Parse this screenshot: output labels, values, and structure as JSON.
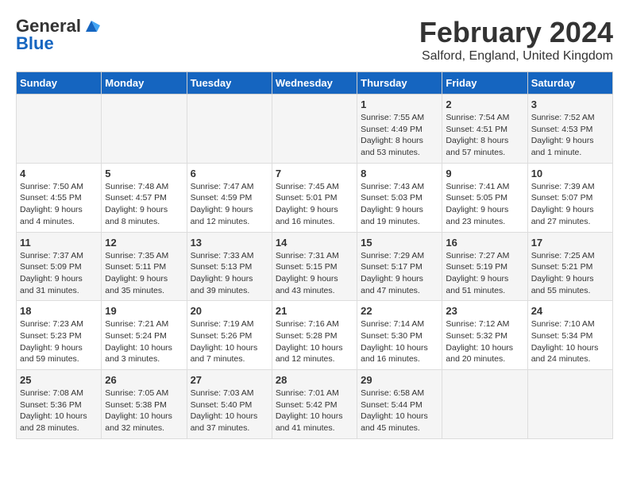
{
  "logo": {
    "general": "General",
    "blue": "Blue"
  },
  "header": {
    "month": "February 2024",
    "location": "Salford, England, United Kingdom"
  },
  "weekdays": [
    "Sunday",
    "Monday",
    "Tuesday",
    "Wednesday",
    "Thursday",
    "Friday",
    "Saturday"
  ],
  "weeks": [
    [
      {
        "day": "",
        "info": ""
      },
      {
        "day": "",
        "info": ""
      },
      {
        "day": "",
        "info": ""
      },
      {
        "day": "",
        "info": ""
      },
      {
        "day": "1",
        "info": "Sunrise: 7:55 AM\nSunset: 4:49 PM\nDaylight: 8 hours\nand 53 minutes."
      },
      {
        "day": "2",
        "info": "Sunrise: 7:54 AM\nSunset: 4:51 PM\nDaylight: 8 hours\nand 57 minutes."
      },
      {
        "day": "3",
        "info": "Sunrise: 7:52 AM\nSunset: 4:53 PM\nDaylight: 9 hours\nand 1 minute."
      }
    ],
    [
      {
        "day": "4",
        "info": "Sunrise: 7:50 AM\nSunset: 4:55 PM\nDaylight: 9 hours\nand 4 minutes."
      },
      {
        "day": "5",
        "info": "Sunrise: 7:48 AM\nSunset: 4:57 PM\nDaylight: 9 hours\nand 8 minutes."
      },
      {
        "day": "6",
        "info": "Sunrise: 7:47 AM\nSunset: 4:59 PM\nDaylight: 9 hours\nand 12 minutes."
      },
      {
        "day": "7",
        "info": "Sunrise: 7:45 AM\nSunset: 5:01 PM\nDaylight: 9 hours\nand 16 minutes."
      },
      {
        "day": "8",
        "info": "Sunrise: 7:43 AM\nSunset: 5:03 PM\nDaylight: 9 hours\nand 19 minutes."
      },
      {
        "day": "9",
        "info": "Sunrise: 7:41 AM\nSunset: 5:05 PM\nDaylight: 9 hours\nand 23 minutes."
      },
      {
        "day": "10",
        "info": "Sunrise: 7:39 AM\nSunset: 5:07 PM\nDaylight: 9 hours\nand 27 minutes."
      }
    ],
    [
      {
        "day": "11",
        "info": "Sunrise: 7:37 AM\nSunset: 5:09 PM\nDaylight: 9 hours\nand 31 minutes."
      },
      {
        "day": "12",
        "info": "Sunrise: 7:35 AM\nSunset: 5:11 PM\nDaylight: 9 hours\nand 35 minutes."
      },
      {
        "day": "13",
        "info": "Sunrise: 7:33 AM\nSunset: 5:13 PM\nDaylight: 9 hours\nand 39 minutes."
      },
      {
        "day": "14",
        "info": "Sunrise: 7:31 AM\nSunset: 5:15 PM\nDaylight: 9 hours\nand 43 minutes."
      },
      {
        "day": "15",
        "info": "Sunrise: 7:29 AM\nSunset: 5:17 PM\nDaylight: 9 hours\nand 47 minutes."
      },
      {
        "day": "16",
        "info": "Sunrise: 7:27 AM\nSunset: 5:19 PM\nDaylight: 9 hours\nand 51 minutes."
      },
      {
        "day": "17",
        "info": "Sunrise: 7:25 AM\nSunset: 5:21 PM\nDaylight: 9 hours\nand 55 minutes."
      }
    ],
    [
      {
        "day": "18",
        "info": "Sunrise: 7:23 AM\nSunset: 5:23 PM\nDaylight: 9 hours\nand 59 minutes."
      },
      {
        "day": "19",
        "info": "Sunrise: 7:21 AM\nSunset: 5:24 PM\nDaylight: 10 hours\nand 3 minutes."
      },
      {
        "day": "20",
        "info": "Sunrise: 7:19 AM\nSunset: 5:26 PM\nDaylight: 10 hours\nand 7 minutes."
      },
      {
        "day": "21",
        "info": "Sunrise: 7:16 AM\nSunset: 5:28 PM\nDaylight: 10 hours\nand 12 minutes."
      },
      {
        "day": "22",
        "info": "Sunrise: 7:14 AM\nSunset: 5:30 PM\nDaylight: 10 hours\nand 16 minutes."
      },
      {
        "day": "23",
        "info": "Sunrise: 7:12 AM\nSunset: 5:32 PM\nDaylight: 10 hours\nand 20 minutes."
      },
      {
        "day": "24",
        "info": "Sunrise: 7:10 AM\nSunset: 5:34 PM\nDaylight: 10 hours\nand 24 minutes."
      }
    ],
    [
      {
        "day": "25",
        "info": "Sunrise: 7:08 AM\nSunset: 5:36 PM\nDaylight: 10 hours\nand 28 minutes."
      },
      {
        "day": "26",
        "info": "Sunrise: 7:05 AM\nSunset: 5:38 PM\nDaylight: 10 hours\nand 32 minutes."
      },
      {
        "day": "27",
        "info": "Sunrise: 7:03 AM\nSunset: 5:40 PM\nDaylight: 10 hours\nand 37 minutes."
      },
      {
        "day": "28",
        "info": "Sunrise: 7:01 AM\nSunset: 5:42 PM\nDaylight: 10 hours\nand 41 minutes."
      },
      {
        "day": "29",
        "info": "Sunrise: 6:58 AM\nSunset: 5:44 PM\nDaylight: 10 hours\nand 45 minutes."
      },
      {
        "day": "",
        "info": ""
      },
      {
        "day": "",
        "info": ""
      }
    ]
  ]
}
